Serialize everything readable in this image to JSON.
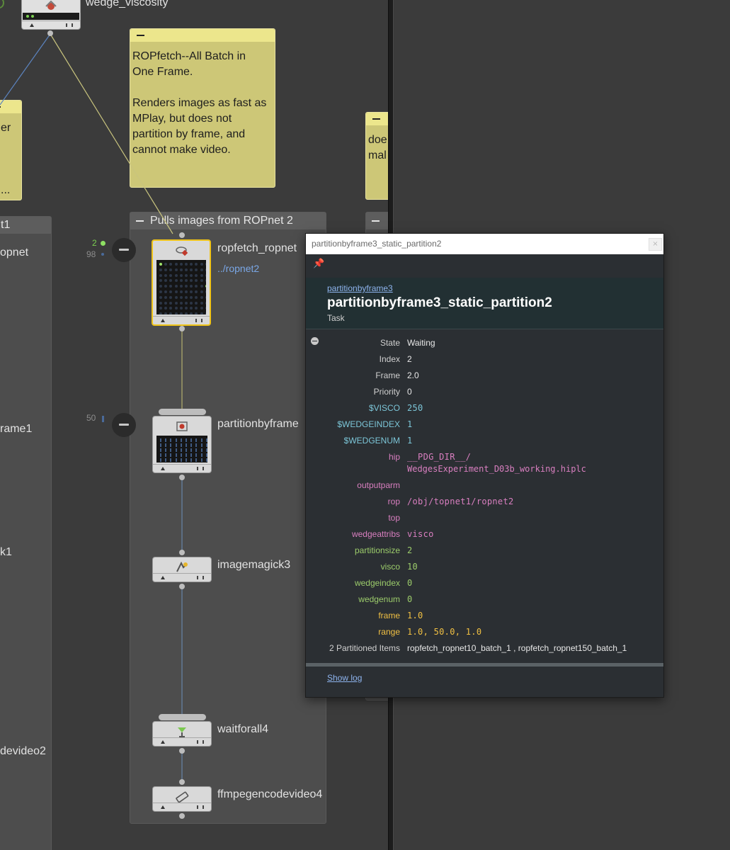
{
  "network": {
    "top_node": {
      "label": "wedge_viscosity"
    },
    "sticky_left": {
      "text": "er\n\n\n\n..."
    },
    "sticky_main": {
      "text": "ROPfetch--All Batch in\nOne Frame.\n\nRenders images as fast as\nMPlay, but does not\npartition by frame, and\ncannot make video."
    },
    "sticky_right": {
      "text": "doe\nmal"
    },
    "left_box": {
      "header": "t1",
      "labels": [
        "opnet",
        "rame1",
        "k1",
        "devideo2"
      ]
    },
    "main_box": {
      "header": "Pulls images from ROPnet 2",
      "nodes": [
        {
          "name": "ropfetch_ropnet",
          "sublabel": "../ropnet2",
          "icon": "ropfetch-icon",
          "count_done": "2",
          "count_waiting": "98"
        },
        {
          "name": "partitionbyframe",
          "icon": "partition-icon",
          "count_waiting": "50"
        },
        {
          "name": "imagemagick3",
          "icon": "imagemagick-icon"
        },
        {
          "name": "waitforall4",
          "icon": "waitforall-icon"
        },
        {
          "name": "ffmpegencodevideo4",
          "icon": "ffmpeg-icon"
        }
      ]
    }
  },
  "task_info": {
    "window_title": "partitionbyframe3_static_partition2",
    "close_glyph": "×",
    "pin_icon": "pin-icon",
    "parent_link": "partitionbyframe3",
    "name": "partitionbyframe3_static_partition2",
    "kind": "Task",
    "attributes": [
      {
        "key": "State",
        "value": "Waiting",
        "key_color": "#d0d0d0",
        "value_color": "#e8e8e8",
        "mono": false
      },
      {
        "key": "Index",
        "value": "2",
        "key_color": "#d0d0d0",
        "value_color": "#e8e8e8",
        "mono": false
      },
      {
        "key": "Frame",
        "value": "2.0",
        "key_color": "#d0d0d0",
        "value_color": "#e8e8e8",
        "mono": false
      },
      {
        "key": "Priority",
        "value": "0",
        "key_color": "#d0d0d0",
        "value_color": "#e8e8e8",
        "mono": false
      },
      {
        "key": "$VISCO",
        "value": "250",
        "key_color": "#7cc6d8",
        "value_color": "#7cc6d8",
        "mono": true
      },
      {
        "key": "$WEDGEINDEX",
        "value": "1",
        "key_color": "#7cc6d8",
        "value_color": "#7cc6d8",
        "mono": true
      },
      {
        "key": "$WEDGENUM",
        "value": "1",
        "key_color": "#7cc6d8",
        "value_color": "#7cc6d8",
        "mono": true
      },
      {
        "key": "hip",
        "value": "__PDG_DIR__/",
        "value2": "WedgesExperiment_D03b_working.hiplc",
        "key_color": "#d97fc0",
        "value_color": "#d97fc0",
        "mono": true
      },
      {
        "key": "outputparm",
        "value": "",
        "key_color": "#d97fc0",
        "value_color": "#d97fc0",
        "mono": true
      },
      {
        "key": "rop",
        "value": "/obj/topnet1/ropnet2",
        "key_color": "#d97fc0",
        "value_color": "#d97fc0",
        "mono": true
      },
      {
        "key": "top",
        "value": "",
        "key_color": "#d97fc0",
        "value_color": "#d97fc0",
        "mono": true
      },
      {
        "key": "wedgeattribs",
        "value": "visco",
        "key_color": "#d97fc0",
        "value_color": "#d97fc0",
        "mono": true
      },
      {
        "key": "partitionsize",
        "value": "2",
        "key_color": "#9ccc6b",
        "value_color": "#9ccc6b",
        "mono": true
      },
      {
        "key": "visco",
        "value": "10",
        "key_color": "#9ccc6b",
        "value_color": "#9ccc6b",
        "mono": true
      },
      {
        "key": "wedgeindex",
        "value": "0",
        "key_color": "#9ccc6b",
        "value_color": "#9ccc6b",
        "mono": true
      },
      {
        "key": "wedgenum",
        "value": "0",
        "key_color": "#9ccc6b",
        "value_color": "#9ccc6b",
        "mono": true
      },
      {
        "key": "frame",
        "value": "1.0",
        "key_color": "#f1c043",
        "value_color": "#f1c043",
        "mono": true
      },
      {
        "key": "range",
        "value": "1.0, 50.0, 1.0",
        "key_color": "#f1c043",
        "value_color": "#f1c043",
        "mono": true
      },
      {
        "key": "2 Partitioned Items",
        "value": "ropfetch_ropnet10_batch_1 , ropfetch_ropnet150_batch_1",
        "key_color": "#d0d0d0",
        "value_color": "#e8e8e8",
        "mono": false
      }
    ],
    "show_log": "Show log"
  }
}
